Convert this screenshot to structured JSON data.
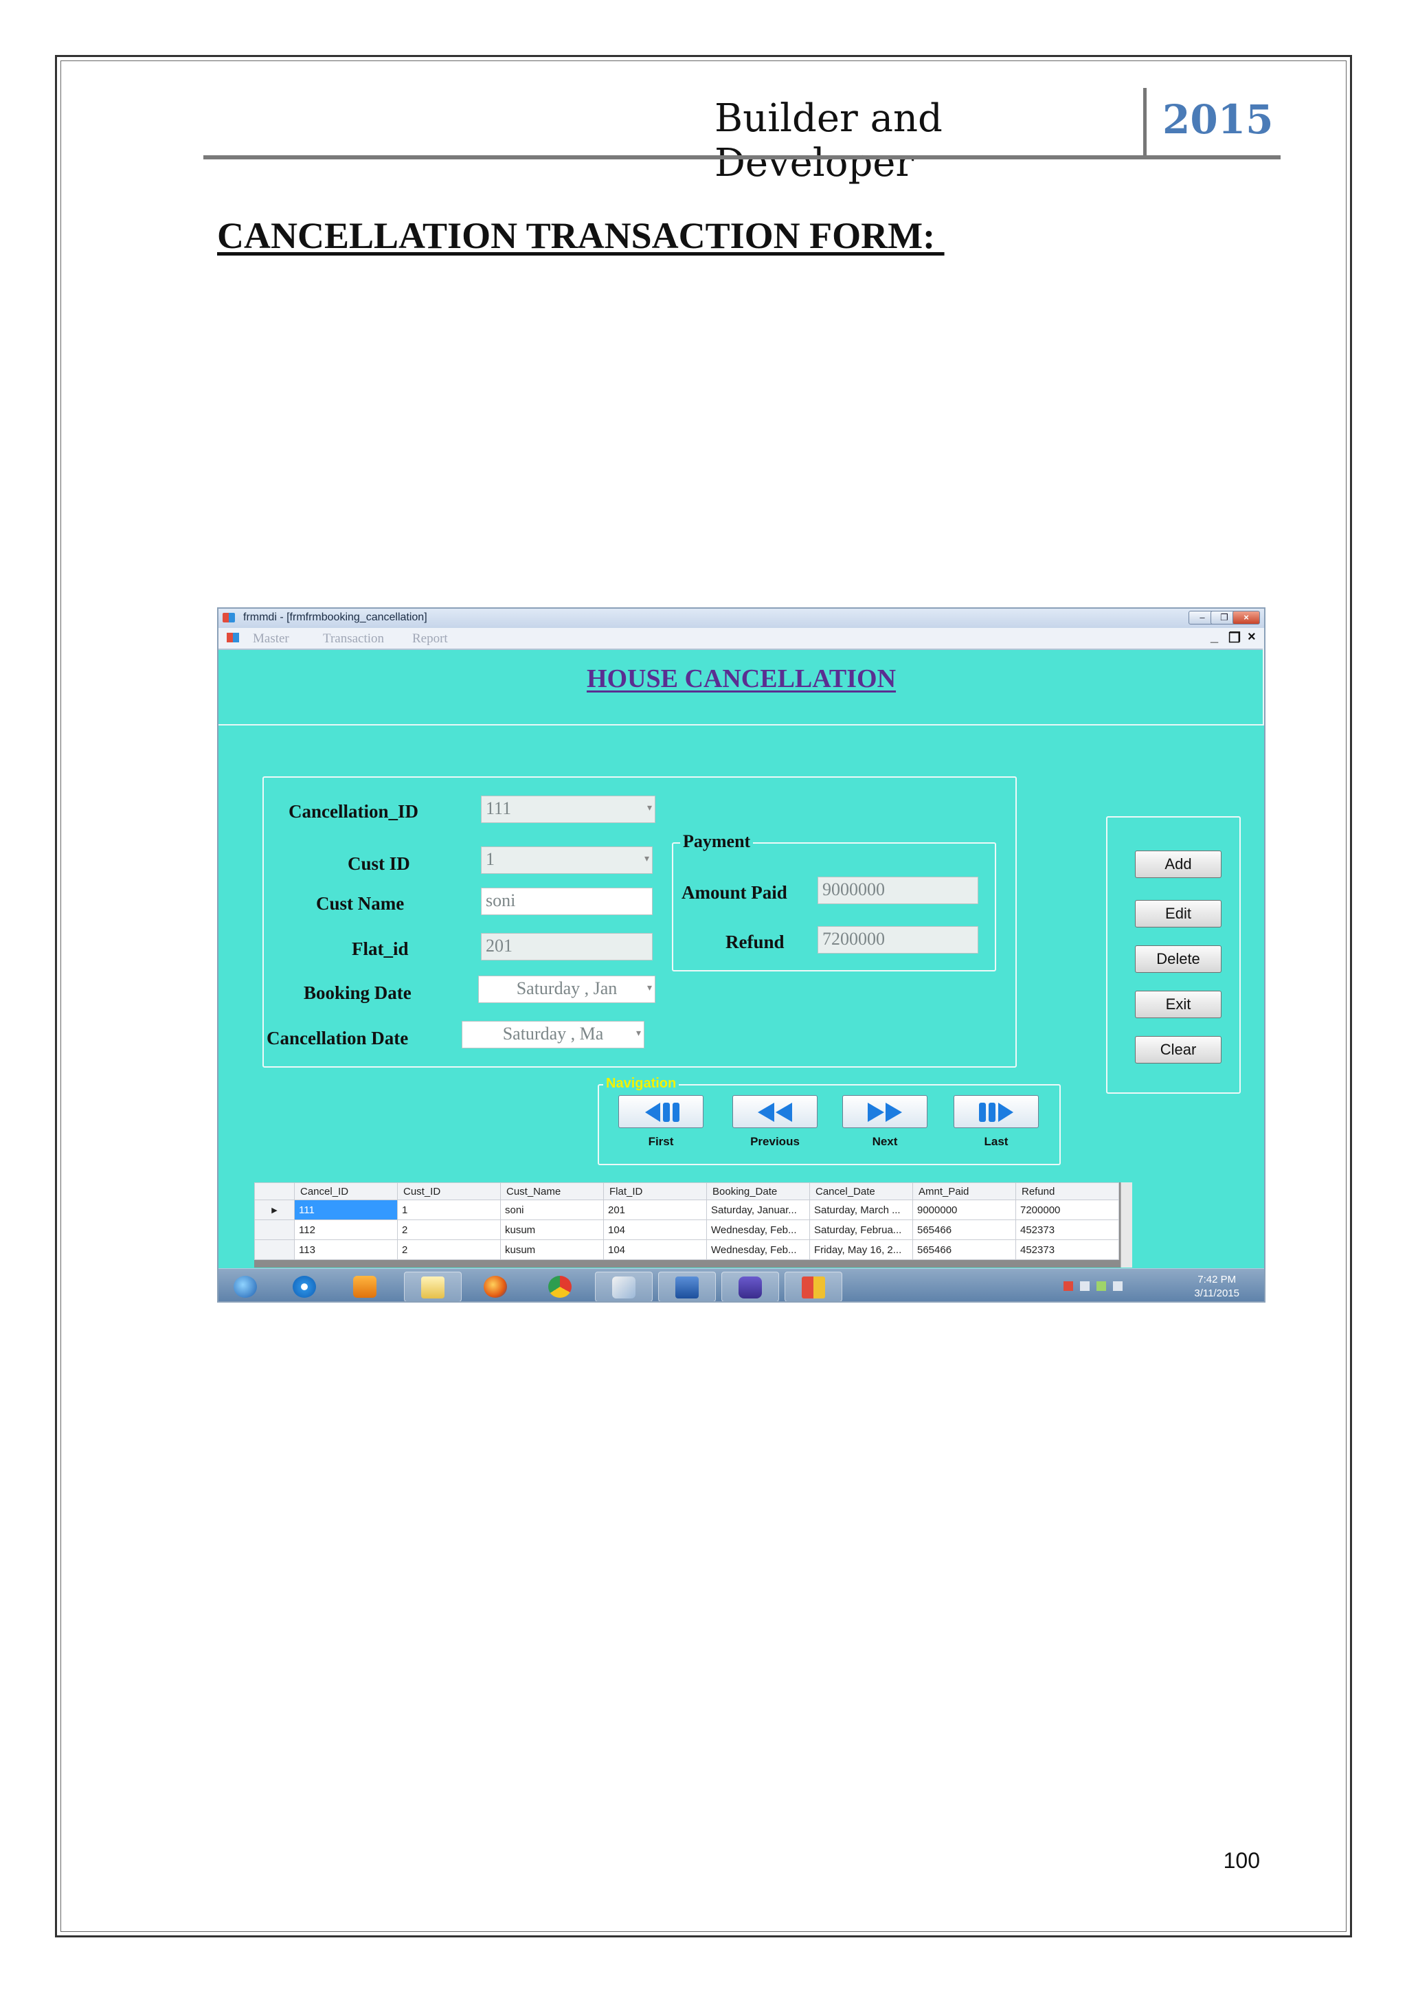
{
  "document": {
    "header_title": "Builder and Developer",
    "header_year": "2015",
    "heading": "CANCELLATION TRANSACTION FORM: ",
    "page_number": "100"
  },
  "window": {
    "title": "frmmdi - [frmfrmbooking_cancellation]",
    "menu": [
      "Master",
      "Transaction",
      "Report"
    ],
    "mdi_controls": [
      "_",
      "❐",
      "×"
    ],
    "form_title": "HOUSE CANCELLATION"
  },
  "form": {
    "labels": {
      "cancellation_id": "Cancellation_ID",
      "cust_id": "Cust ID",
      "cust_name": "Cust Name",
      "flat_id": "Flat_id",
      "booking_date": "Booking Date",
      "cancellation_date": "Cancellation Date"
    },
    "values": {
      "cancellation_id": "111",
      "cust_id": "1",
      "cust_name": "soni",
      "flat_id": "201",
      "booking_date": "Saturday ,   Jan",
      "cancellation_date": "Saturday ,    Ma"
    },
    "payment": {
      "legend": "Payment",
      "amount_paid_label": "Amount Paid",
      "amount_paid": "9000000",
      "refund_label": "Refund",
      "refund": "7200000"
    }
  },
  "buttons": {
    "add": "Add",
    "edit": "Edit",
    "delete": "Delete",
    "exit": "Exit",
    "clear": "Clear"
  },
  "navigation": {
    "legend": "Navigation",
    "first": "First",
    "previous": "Previous",
    "next": "Next",
    "last": "Last"
  },
  "grid": {
    "columns": [
      "Cancel_ID",
      "Cust_ID",
      "Cust_Name",
      "Flat_ID",
      "Booking_Date",
      "Cancel_Date",
      "Amnt_Paid",
      "Refund"
    ],
    "rows": [
      [
        "111",
        "1",
        "soni",
        "201",
        "Saturday, Januar...",
        "Saturday, March ...",
        "9000000",
        "7200000"
      ],
      [
        "112",
        "2",
        "kusum",
        "104",
        "Wednesday, Feb...",
        "Saturday, Februa...",
        "565466",
        "452373"
      ],
      [
        "113",
        "2",
        "kusum",
        "104",
        "Wednesday, Feb...",
        "Friday, May 16, 2...",
        "565466",
        "452373"
      ]
    ]
  },
  "taskbar": {
    "time": "7:42 PM",
    "date": "3/11/2015"
  }
}
